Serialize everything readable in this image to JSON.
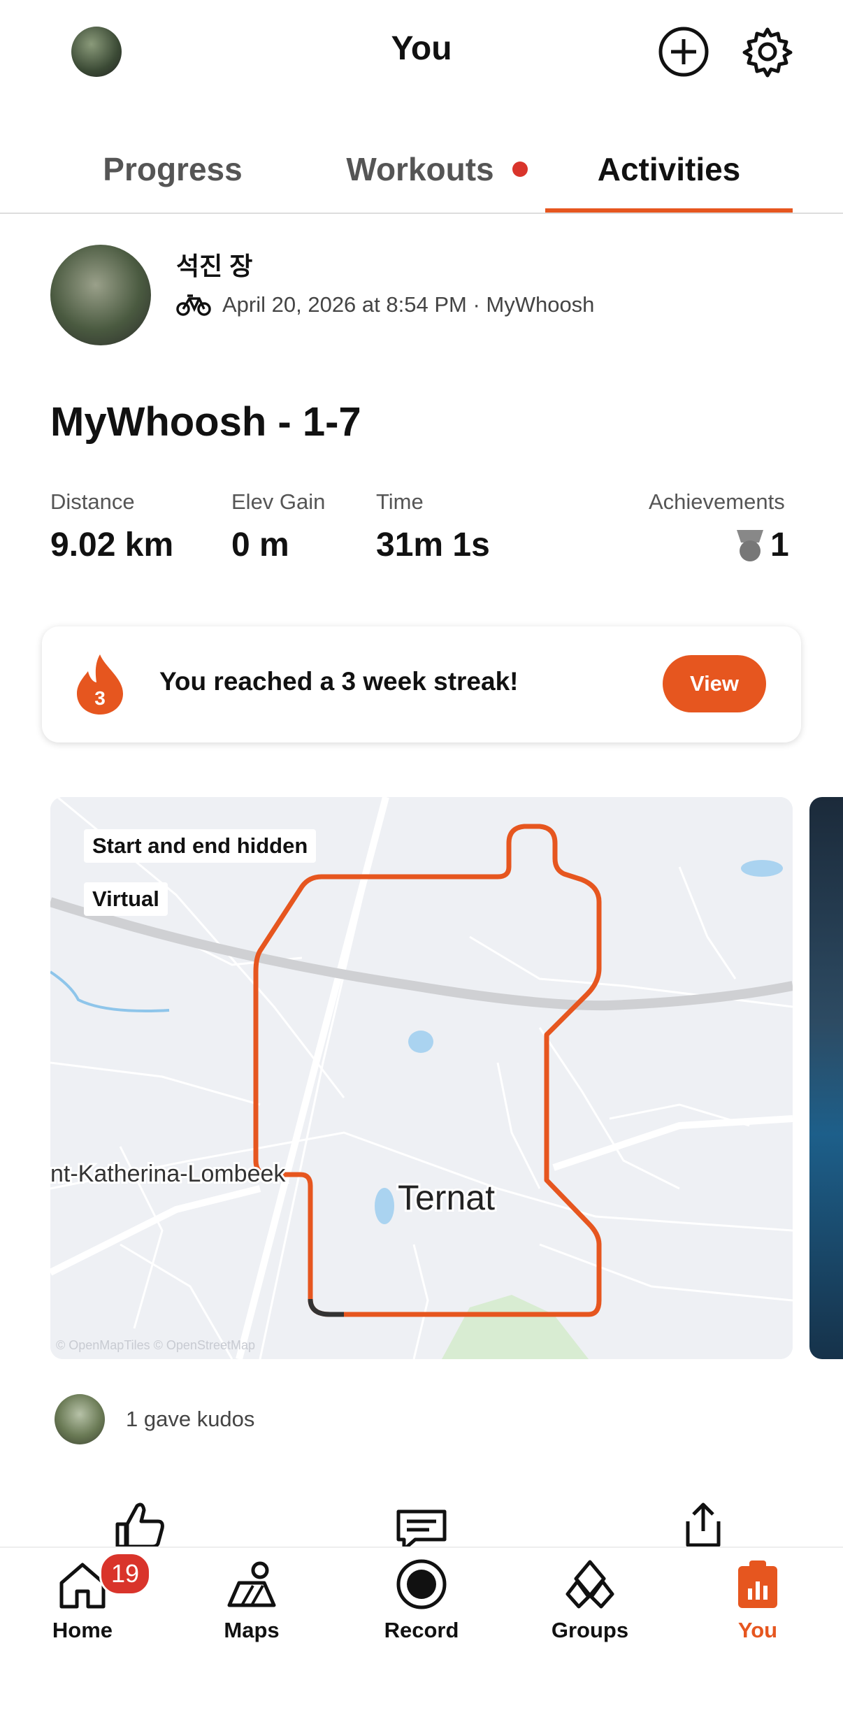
{
  "header": {
    "title": "You",
    "add_icon": "plus-circle-icon",
    "settings_icon": "gear-icon"
  },
  "tabs": [
    {
      "label": "Progress",
      "active": false
    },
    {
      "label": "Workouts",
      "active": false,
      "has_dot": true
    },
    {
      "label": "Activities",
      "active": true
    }
  ],
  "activity": {
    "athlete_name": "석진 장",
    "meta": "April 20, 2026 at 8:54 PM · MyWhoosh",
    "sport_icon": "bike-icon",
    "title": "MyWhoosh - 1-7",
    "stats": [
      {
        "label": "Distance",
        "value": "9.02 km"
      },
      {
        "label": "Elev Gain",
        "value": "0 m"
      },
      {
        "label": "Time",
        "value": "31m 1s"
      },
      {
        "label": "Achievements",
        "value": "1"
      }
    ]
  },
  "streak": {
    "count": "3",
    "text": "You reached a 3 week streak!",
    "button": "View"
  },
  "map": {
    "badges": [
      "Start and end hidden",
      "Virtual"
    ],
    "place_large": "Ternat",
    "place_small": "nt-Katherina-Lombeek",
    "attribution": "© OpenMapTiles © OpenStreetMap",
    "route_color": "#e6561f"
  },
  "kudos": {
    "text": "1 gave kudos"
  },
  "actions": [
    "thumbs-up-icon",
    "comment-icon",
    "share-icon"
  ],
  "bottom_nav": [
    {
      "label": "Home",
      "icon": "home-icon",
      "badge": "19"
    },
    {
      "label": "Maps",
      "icon": "map-icon"
    },
    {
      "label": "Record",
      "icon": "record-icon"
    },
    {
      "label": "Groups",
      "icon": "groups-icon"
    },
    {
      "label": "You",
      "icon": "you-icon",
      "active": true
    }
  ],
  "colors": {
    "accent": "#e6561f",
    "dot": "#d9342b"
  }
}
